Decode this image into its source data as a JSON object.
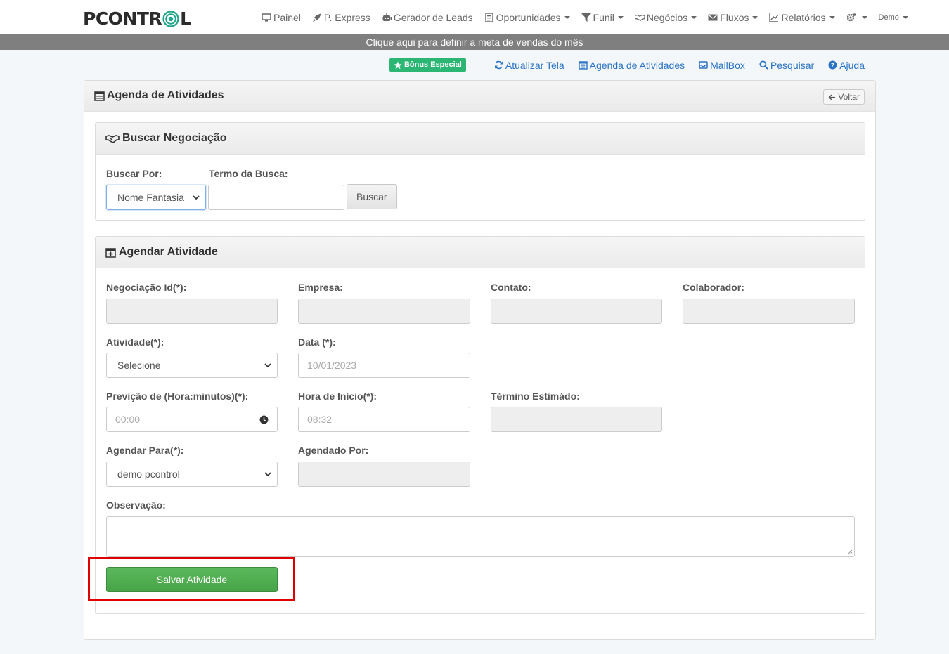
{
  "brand": {
    "logo_left": "PCONTR",
    "logo_right": "L"
  },
  "nav": [
    {
      "label": "Painel",
      "icon": "monitor-icon",
      "caret": false
    },
    {
      "label": "P. Express",
      "icon": "rocket-icon",
      "caret": false
    },
    {
      "label": "Gerador de Leads",
      "icon": "robot-icon",
      "caret": false
    },
    {
      "label": "Oportunidades",
      "icon": "document-icon",
      "caret": true
    },
    {
      "label": "Funil",
      "icon": "funnel-icon",
      "caret": true
    },
    {
      "label": "Negócios",
      "icon": "handshake-icon",
      "caret": true
    },
    {
      "label": "Fluxos",
      "icon": "envelope-icon",
      "caret": true
    },
    {
      "label": "Relatórios",
      "icon": "line-chart-icon",
      "caret": true
    },
    {
      "label": "",
      "icon": "gears-icon",
      "caret": true
    },
    {
      "label": "Demo",
      "icon": "",
      "caret": true
    }
  ],
  "goal_banner": "Clique aqui para definir a meta de vendas do mês",
  "toolbar": {
    "bonus": "Bônus Especial",
    "refresh": "Atualizar Tela",
    "agenda": "Agenda de Atividades",
    "mailbox": "MailBox",
    "search": "Pesquisar",
    "help": "Ajuda"
  },
  "page": {
    "title": "Agenda de Atividades",
    "back": "Voltar"
  },
  "search_panel": {
    "title": "Buscar Negociação",
    "by_label": "Buscar Por:",
    "by_value": "Nome Fantasia",
    "term_label": "Termo da Busca:",
    "term_value": "",
    "button": "Buscar"
  },
  "schedule_panel": {
    "title": "Agendar Atividade",
    "negotiation_id_label": "Negociação Id(*):",
    "negotiation_id_value": "",
    "company_label": "Empresa:",
    "company_value": "",
    "contact_label": "Contato:",
    "contact_value": "",
    "collaborator_label": "Colaborador:",
    "collaborator_value": "",
    "activity_label": "Atividade(*):",
    "activity_value": "Selecione",
    "date_label": "Data (*):",
    "date_placeholder": "10/01/2023",
    "forecast_label": "Previção de (Hora:minutos)(*):",
    "forecast_placeholder": "00:00",
    "start_label": "Hora de Início(*):",
    "start_placeholder": "08:32",
    "end_label": "Término Estimádo:",
    "end_value": "",
    "assign_label": "Agendar Para(*):",
    "assign_value": "demo pcontrol",
    "scheduled_by_label": "Agendado Por:",
    "scheduled_by_value": "",
    "notes_label": "Observação:",
    "notes_value": "",
    "save_button": "Salvar Atividade"
  },
  "colors": {
    "accent": "#2a73c4",
    "success": "#5cb85c",
    "bonus": "#2bb673",
    "highlight": "#e00000",
    "banner": "#7f7f7f"
  }
}
